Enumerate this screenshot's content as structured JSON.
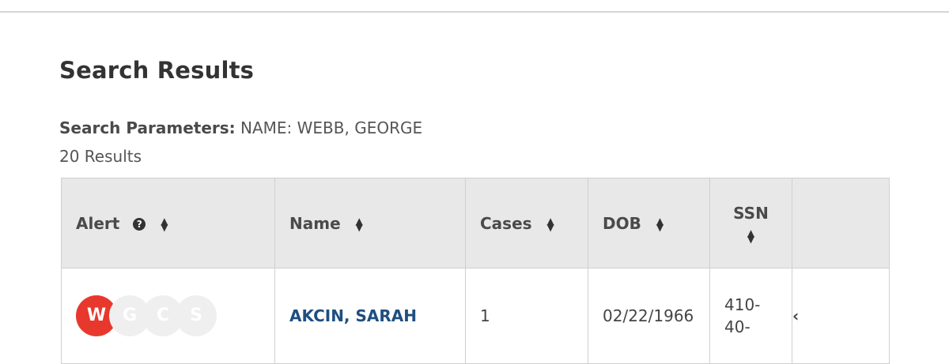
{
  "page": {
    "title": "Search Results",
    "params_label": "Search Parameters:",
    "params_value": "NAME: WEBB, GEORGE",
    "result_count": "20 Results"
  },
  "table": {
    "headers": {
      "alert": "Alert",
      "name": "Name",
      "cases": "Cases",
      "dob": "DOB",
      "ssn": "SSN"
    },
    "rows": [
      {
        "badges": [
          "W",
          "G",
          "C",
          "S"
        ],
        "badge_active": [
          true,
          false,
          false,
          false
        ],
        "name": "AKCIN, SARAH",
        "cases": "1",
        "dob": "02/22/1966",
        "ssn_lines": [
          "410-",
          "40-"
        ]
      }
    ]
  },
  "colors": {
    "alert_active": "#e8382d",
    "link": "#1e4f7f",
    "header_bg": "#e8e8e8"
  },
  "icons": {
    "help": "question-circle-icon",
    "sort": "sort-icon",
    "expand": "chevron-left-icon"
  }
}
